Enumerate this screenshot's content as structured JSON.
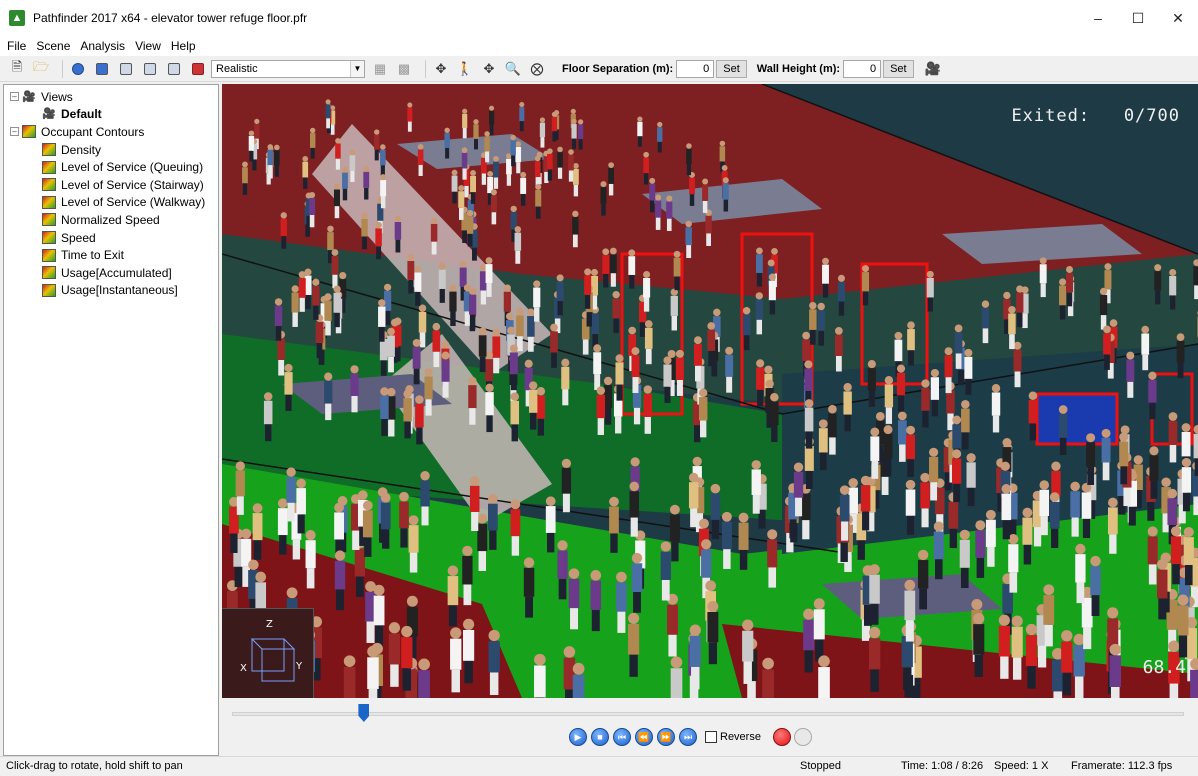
{
  "window": {
    "title": "Pathfinder 2017 x64 - elevator tower refuge floor.pfr",
    "minimize": "–",
    "maximize": "☐",
    "close": "✕"
  },
  "menu": [
    "File",
    "Scene",
    "Analysis",
    "View",
    "Help"
  ],
  "toolbar": {
    "render_mode": "Realistic",
    "floor_sep_label": "Floor Separation (m):",
    "floor_sep_value": "0",
    "wall_height_label": "Wall Height (m):",
    "wall_height_value": "0",
    "set_label": "Set",
    "icons": [
      "new-file-icon",
      "open-folder-icon",
      "select-icon",
      "view-icon",
      "copy-icon",
      "paste-icon",
      "duplicate-icon",
      "render-icon",
      "orbit-icon",
      "walk-icon",
      "pan-icon",
      "zoom-icon",
      "zoom-extents-icon",
      "camera-icon"
    ]
  },
  "tree": {
    "views_label": "Views",
    "default_view": "Default",
    "contours_label": "Occupant Contours",
    "contours": [
      "Density",
      "Level of Service (Queuing)",
      "Level of Service (Stairway)",
      "Level of Service (Walkway)",
      "Normalized Speed",
      "Speed",
      "Time to Exit",
      "Usage[Accumulated]",
      "Usage[Instantaneous]"
    ]
  },
  "viewport": {
    "exited_label": "Exited:",
    "exited_value": "0/700",
    "frame_readout": "68.4",
    "axis": {
      "z": "Z",
      "x": "X",
      "y": "Y"
    }
  },
  "playback": {
    "progress": 0.138,
    "reverse_label": "Reverse",
    "controls": [
      "play",
      "stop",
      "skip-to-start",
      "step-back",
      "step-forward",
      "skip-to-end"
    ]
  },
  "status": {
    "hint": "Click-drag to rotate, hold shift to pan",
    "state": "Stopped",
    "time": "Time: 1:08 / 8:26",
    "speed": "Speed: 1 X",
    "framerate": "Framerate: 112.3 fps"
  }
}
